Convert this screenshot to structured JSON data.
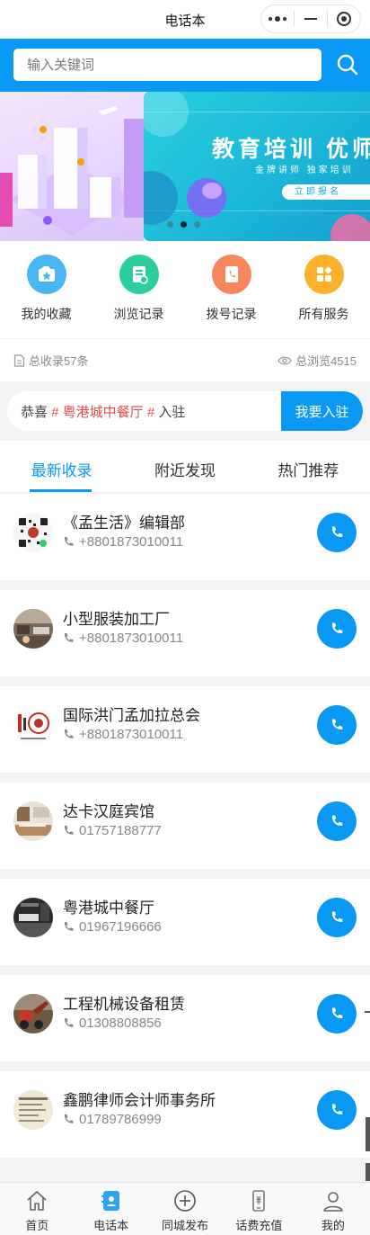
{
  "window": {
    "title": "电话本"
  },
  "search": {
    "placeholder": "输入关键词"
  },
  "banner": {
    "headline": "教育培训 优师",
    "subline": "金牌讲师 独家培训",
    "cta": "立即报名"
  },
  "quick_menu": [
    {
      "label": "我的收藏",
      "icon": "star-folder-icon",
      "color": "#47b6f3"
    },
    {
      "label": "浏览记录",
      "icon": "browse-history-icon",
      "color": "#2ecda0"
    },
    {
      "label": "拨号记录",
      "icon": "dial-record-icon",
      "color": "#f7875a"
    },
    {
      "label": "所有服务",
      "icon": "all-services-icon",
      "color": "#fbb12a"
    }
  ],
  "stats": {
    "total_listed": "总收录57条",
    "total_views": "总浏览4515"
  },
  "notice": {
    "prefix": "恭喜 ",
    "highlight": "# 粤港城中餐厅 #",
    "suffix": " 入驻",
    "join_button": "我要入驻"
  },
  "tabs": [
    {
      "label": "最新收录",
      "active": true
    },
    {
      "label": "附近发现",
      "active": false
    },
    {
      "label": "热门推荐",
      "active": false
    }
  ],
  "entries": [
    {
      "name": "《孟生活》编辑部",
      "phone": "+8801873010011",
      "avatar": "qr-code-avatar"
    },
    {
      "name": "小型服装加工厂",
      "phone": "+8801873010011",
      "avatar": "workshop-photo-avatar"
    },
    {
      "name": "国际洪门孟加拉总会",
      "phone": "+8801873010011",
      "avatar": "association-logo-avatar"
    },
    {
      "name": "达卡汉庭宾馆",
      "phone": "01757188777",
      "avatar": "hotel-room-avatar"
    },
    {
      "name": "粤港城中餐厅",
      "phone": "01967196666",
      "avatar": "restaurant-vip-avatar"
    },
    {
      "name": "工程机械设备租赁",
      "phone": "01308808856",
      "avatar": "machinery-avatar"
    },
    {
      "name": "鑫鹏律师会计师事务所",
      "phone": "01789786999",
      "avatar": "law-firm-avatar"
    }
  ],
  "bottom_nav": [
    {
      "label": "首页",
      "icon": "home-icon"
    },
    {
      "label": "电话本",
      "icon": "phonebook-icon",
      "active": true
    },
    {
      "label": "同城发布",
      "icon": "add-circle-icon"
    },
    {
      "label": "话费充值",
      "icon": "phone-recharge-icon"
    },
    {
      "label": "我的",
      "icon": "user-icon"
    }
  ],
  "colors": {
    "primary": "#0a98f5",
    "highlight": "#e34d4d"
  }
}
